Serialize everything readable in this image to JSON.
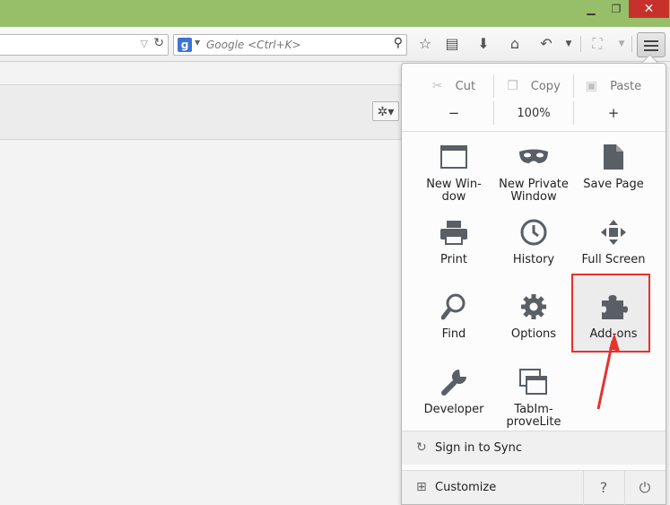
{
  "search": {
    "placeholder": "Google <Ctrl+K>",
    "engine_letter": "g"
  },
  "edit": {
    "cut": "Cut",
    "copy": "Copy",
    "paste": "Paste"
  },
  "zoom": {
    "minus": "−",
    "level": "100%",
    "plus": "+"
  },
  "menu_items": [
    {
      "label": "New Win-\ndow",
      "icon": "new-window-icon"
    },
    {
      "label": "New Private Window",
      "icon": "private-mask-icon"
    },
    {
      "label": "Save Page",
      "icon": "save-page-icon"
    },
    {
      "label": "Print",
      "icon": "printer-icon"
    },
    {
      "label": "History",
      "icon": "clock-icon"
    },
    {
      "label": "Full Screen",
      "icon": "fullscreen-icon"
    },
    {
      "label": "Find",
      "icon": "magnifier-icon"
    },
    {
      "label": "Options",
      "icon": "gear-icon"
    },
    {
      "label": "Add-ons",
      "icon": "puzzle-icon"
    },
    {
      "label": "Developer",
      "icon": "wrench-icon"
    },
    {
      "label": "TabIm-\nproveLite",
      "icon": "tabs-icon"
    }
  ],
  "footer": {
    "sync": "Sign in to Sync",
    "customize": "Customize"
  },
  "colors": {
    "titlebar": "#97bf69",
    "highlight": "#e5322d",
    "icon": "#5a5f66"
  }
}
